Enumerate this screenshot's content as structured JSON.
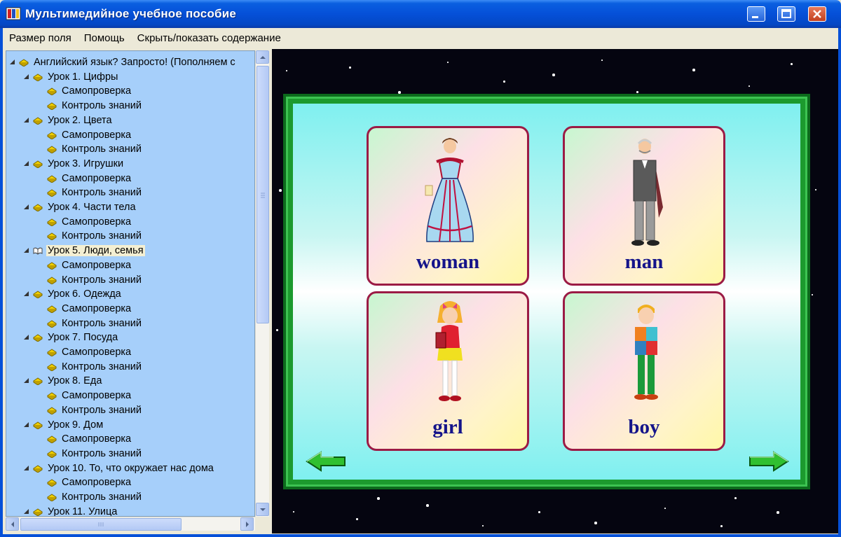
{
  "window": {
    "title": "Мультимедийное учебное пособие"
  },
  "menu": [
    {
      "label": "Размер поля"
    },
    {
      "label": "Помощь"
    },
    {
      "label": "Скрыть/показать содержание"
    }
  ],
  "tree": {
    "root": "Английский язык? Запросто! (Пополняем с",
    "rows": [
      {
        "label": "Урок 1. Цифры",
        "level": 1
      },
      {
        "label": "Самопроверка",
        "level": 2
      },
      {
        "label": "Контроль знаний",
        "level": 2
      },
      {
        "label": "Урок 2. Цвета",
        "level": 1
      },
      {
        "label": "Самопроверка",
        "level": 2
      },
      {
        "label": "Контроль знаний",
        "level": 2
      },
      {
        "label": "Урок 3. Игрушки",
        "level": 1
      },
      {
        "label": "Самопроверка",
        "level": 2
      },
      {
        "label": "Контроль знаний",
        "level": 2
      },
      {
        "label": "Урок 4. Части тела",
        "level": 1
      },
      {
        "label": "Самопроверка",
        "level": 2
      },
      {
        "label": "Контроль знаний",
        "level": 2
      },
      {
        "label": "Урок 5. Люди, семья",
        "level": 1,
        "selected": true
      },
      {
        "label": "Самопроверка",
        "level": 2
      },
      {
        "label": "Контроль знаний",
        "level": 2
      },
      {
        "label": "Урок 6. Одежда",
        "level": 1
      },
      {
        "label": "Самопроверка",
        "level": 2
      },
      {
        "label": "Контроль знаний",
        "level": 2
      },
      {
        "label": "Урок 7. Посуда",
        "level": 1
      },
      {
        "label": "Самопроверка",
        "level": 2
      },
      {
        "label": "Контроль знаний",
        "level": 2
      },
      {
        "label": "Урок 8. Еда",
        "level": 1
      },
      {
        "label": "Самопроверка",
        "level": 2
      },
      {
        "label": "Контроль знаний",
        "level": 2
      },
      {
        "label": "Урок 9. Дом",
        "level": 1
      },
      {
        "label": "Самопроверка",
        "level": 2
      },
      {
        "label": "Контроль знаний",
        "level": 2
      },
      {
        "label": "Урок 10. То, что окружает нас дома",
        "level": 1
      },
      {
        "label": "Самопроверка",
        "level": 2
      },
      {
        "label": "Контроль знаний",
        "level": 2
      },
      {
        "label": "Урок 11. Улица",
        "level": 1
      }
    ]
  },
  "cards": [
    {
      "word": "woman",
      "icon": "woman-illustration"
    },
    {
      "word": "man",
      "icon": "man-illustration"
    },
    {
      "word": "girl",
      "icon": "girl-illustration"
    },
    {
      "word": "boy",
      "icon": "boy-illustration"
    }
  ],
  "colors": {
    "titlebar": "#0550d8",
    "tree_bg": "#a6cffa",
    "frame_green": "#1c9a2e",
    "card_border": "#9b1b45",
    "word_color": "#14148a"
  }
}
